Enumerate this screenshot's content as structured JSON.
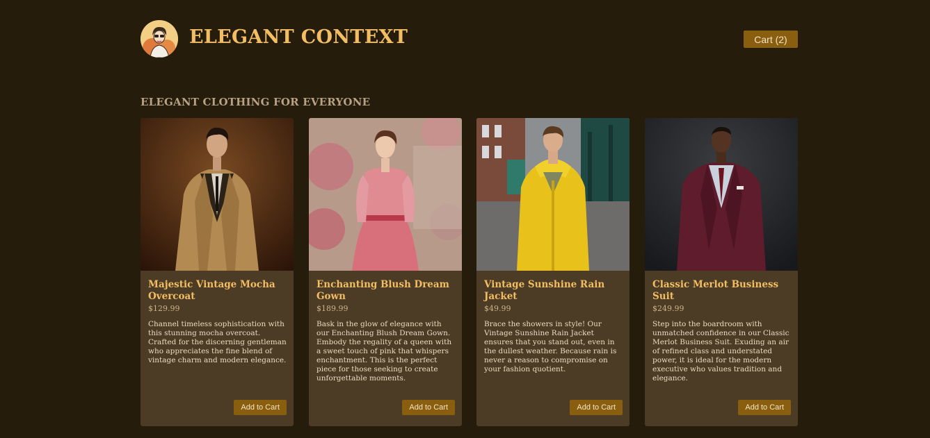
{
  "header": {
    "brand": "ELEGANT CONTEXT",
    "cart_label": "Cart (2)"
  },
  "section": {
    "title": "ELEGANT CLOTHING FOR EVERYONE"
  },
  "products": [
    {
      "title": "Majestic Vintage Mocha Overcoat",
      "price": "$129.99",
      "description": "Channel timeless sophistication with this stunning mocha overcoat. Crafted for the discerning gentleman who appreciates the fine blend of vintage charm and modern elegance.",
      "button": "Add to Cart"
    },
    {
      "title": "Enchanting Blush Dream Gown",
      "price": "$189.99",
      "description": "Bask in the glow of elegance with our Enchanting Blush Dream Gown. Embody the regality of a queen with a sweet touch of pink that whispers enchantment. This is the perfect piece for those seeking to create unforgettable moments.",
      "button": "Add to Cart"
    },
    {
      "title": "Vintage Sunshine Rain Jacket",
      "price": "$49.99",
      "description": "Brace the showers in style! Our Vintage Sunshine Rain Jacket ensures that you stand out, even in the dullest weather. Because rain is never a reason to compromise on your fashion quotient.",
      "button": "Add to Cart"
    },
    {
      "title": "Classic Merlot Business Suit",
      "price": "$249.99",
      "description": "Step into the boardroom with unmatched confidence in our Classic Merlot Business Suit. Exuding an air of refined class and understated power, it is ideal for the modern executive who values tradition and elegance.",
      "button": "Add to Cart"
    }
  ]
}
